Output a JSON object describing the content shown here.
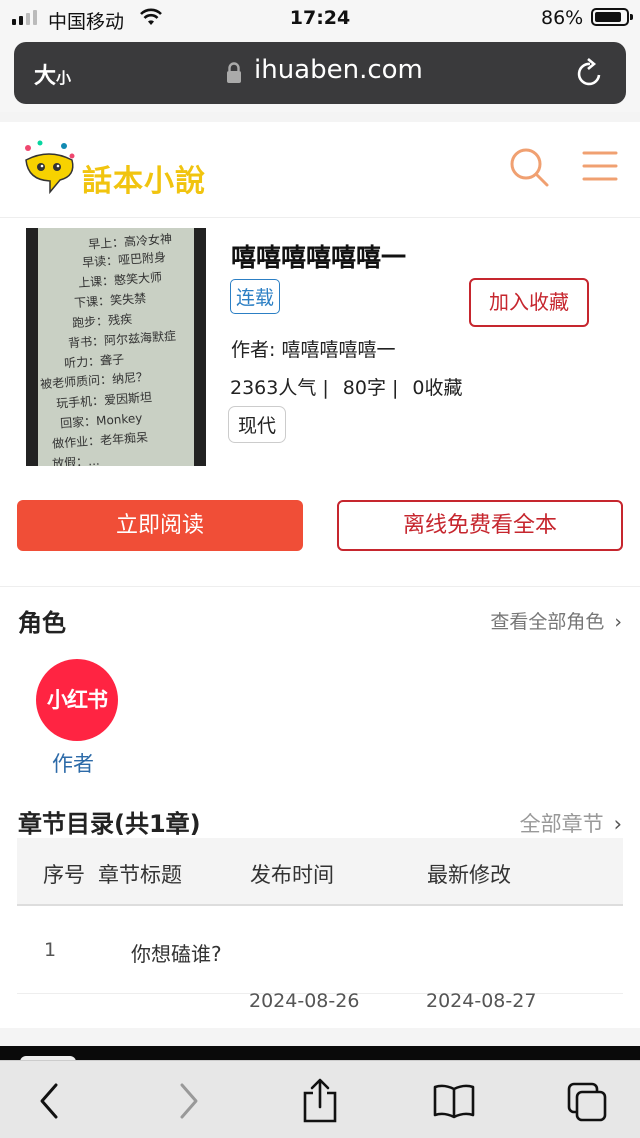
{
  "status_bar": {
    "carrier": "中国移动",
    "time": "17:24",
    "battery": "86%",
    "battery_level": 0.86
  },
  "browser": {
    "text_size": "大",
    "text_size_small": "小",
    "url": "ihuaben.com"
  },
  "site": {
    "logo_text": "話本小說"
  },
  "book": {
    "cover_lines": [
      "早上：高冷女神",
      "早读：哑巴附身",
      "上课：憨笑大师",
      "下课：笑失禁",
      "跑步：残疾",
      "背书：阿尔兹海默症",
      "听力：聋子",
      "被老师质问：纳尼？",
      "玩手机：爱因斯坦",
      "回家：Monkey",
      "做作业：老年痴呆",
      "放假：..."
    ],
    "title": "嘻嘻嘻嘻嘻嘻一",
    "status_tag": "连载",
    "collect_button": "加入收藏",
    "author_line": "作者: 嘻嘻嘻嘻嘻一",
    "stats": [
      "2363人气 |",
      "80字 |",
      "0收藏"
    ],
    "genre_tag": "现代",
    "read_button": "立即阅读",
    "offline_button": "离线免费看全本"
  },
  "characters": {
    "title": "角色",
    "view_all": "查看全部角色",
    "items": [
      {
        "avatar_text": "小红书",
        "label": "作者",
        "color": "#ff2442"
      }
    ]
  },
  "chapters": {
    "title": "章节目录(共1章)",
    "view_all": "全部章节",
    "headers": [
      "序号",
      "章节标题",
      "发布时间",
      "最新修改"
    ],
    "rows": [
      {
        "index": "1",
        "title": "你想磕谁?",
        "published": "2024-08-26",
        "modified": "2024-08-27"
      }
    ]
  },
  "colors": {
    "accent_red": "#f04e37",
    "border_red": "#c6262e",
    "link_blue": "#2c7fc4",
    "logo_yellow": "#f1c40f",
    "icon_orange": "#f0a071"
  }
}
